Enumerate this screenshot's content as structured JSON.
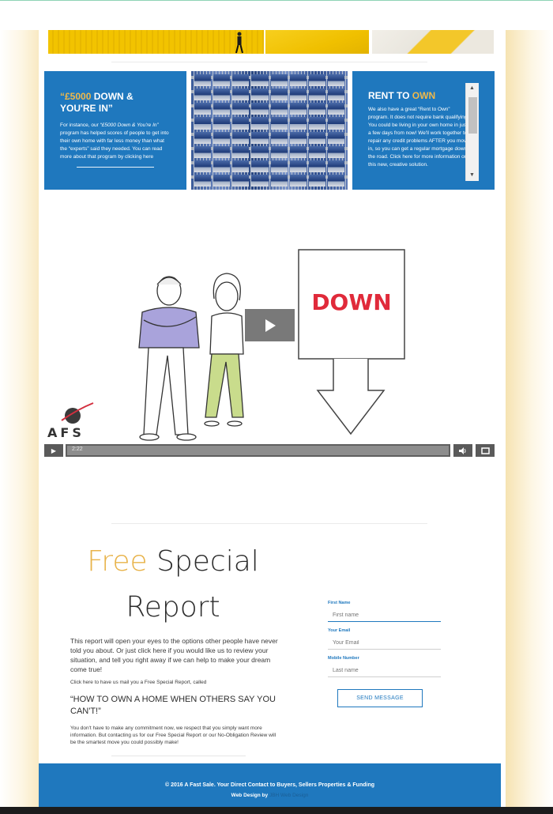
{
  "tiles": {
    "tile1": {
      "title_hl": "“£5000",
      "title_rest": " DOWN & YOU'RE IN”",
      "text_prefix": "For instance, our ",
      "text_italic": "“£5000 Down & You're In”",
      "text_rest": " program has helped scores of people to get into their own home with far less money than what the “experts” said they needed. You can read more about that program by clicking here"
    },
    "tile3": {
      "title_pre": "RENT TO ",
      "title_hl": "OWN",
      "text": "We also have a great “Rent to Own” program. It does not require bank qualifying. You could be living in your own home in just a few days from now! We'll work together to repair any credit problems AFTER you move in, so you can get a regular mortgage down the road. Click here for more information on this new, creative solution."
    }
  },
  "video": {
    "sign_text": "DOWN",
    "time": "2:22",
    "logo_text": "AFS"
  },
  "report": {
    "title_free": "Free",
    "title_special": " Special",
    "title_report": "Report",
    "p1": "This report will open your eyes to the options other people have never told you about. Or just click here if you would like us to review your situation, and tell you right away if we can help to make your dream come true!",
    "p2": "Click here to have us mail you a Free Special Report, called",
    "heading": "“HOW TO OWN A HOME WHEN OTHERS SAY YOU CAN'T!”",
    "p3": "You don't have to make any commitment now, we respect that you simply want more information. But contacting us for our Free Special Report or our No-Obligation Review will be the smartest move you could possibly make!"
  },
  "form": {
    "first_name_label": "First Name",
    "first_name_placeholder": "First name",
    "email_label": "Your Email",
    "email_placeholder": "Your Email",
    "mobile_label": "Mobile Number",
    "mobile_placeholder": "Last name",
    "submit_label": "SEND MESSAGE"
  },
  "footer": {
    "copyright": "© 2016 A Fast Sale. Your Direct Contact to Buyers, Sellers Properties & Funding",
    "credit_prefix": "Web Design by ",
    "credit_name": "JBH Web Design"
  },
  "colors": {
    "brand_blue": "#1f78be",
    "accent_gold": "#e8b34a"
  }
}
